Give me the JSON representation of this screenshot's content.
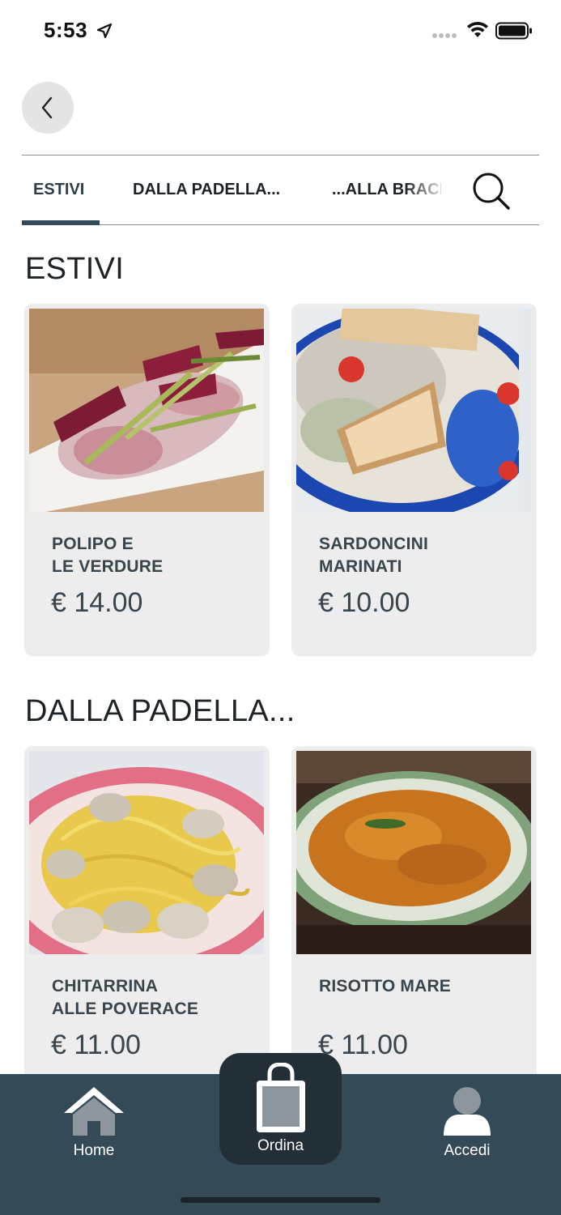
{
  "status_bar": {
    "time": "5:53"
  },
  "tabs": [
    {
      "label": "ESTIVI",
      "active": true
    },
    {
      "label": "DALLA PADELLA..."
    },
    {
      "label": "...ALLA BRACE"
    }
  ],
  "sections": [
    {
      "title": "ESTIVI",
      "items": [
        {
          "name": "POLIPO E\nLE VERDURE",
          "price": "€ 14.00"
        },
        {
          "name": "SARDONCINI\nMARINATI",
          "price": "€ 10.00"
        }
      ]
    },
    {
      "title": "DALLA PADELLA...",
      "items": [
        {
          "name": "CHITARRINA\nALLE POVERACE",
          "price": "€ 11.00"
        },
        {
          "name": "RISOTTO MARE",
          "price": "€ 11.00"
        }
      ]
    }
  ],
  "bottom_nav": {
    "home": "Home",
    "ordina": "Ordina",
    "accedi": "Accedi"
  },
  "colors": {
    "nav_bg": "#344a57",
    "active_tab": "#334a57",
    "card_bg": "#ededed"
  }
}
